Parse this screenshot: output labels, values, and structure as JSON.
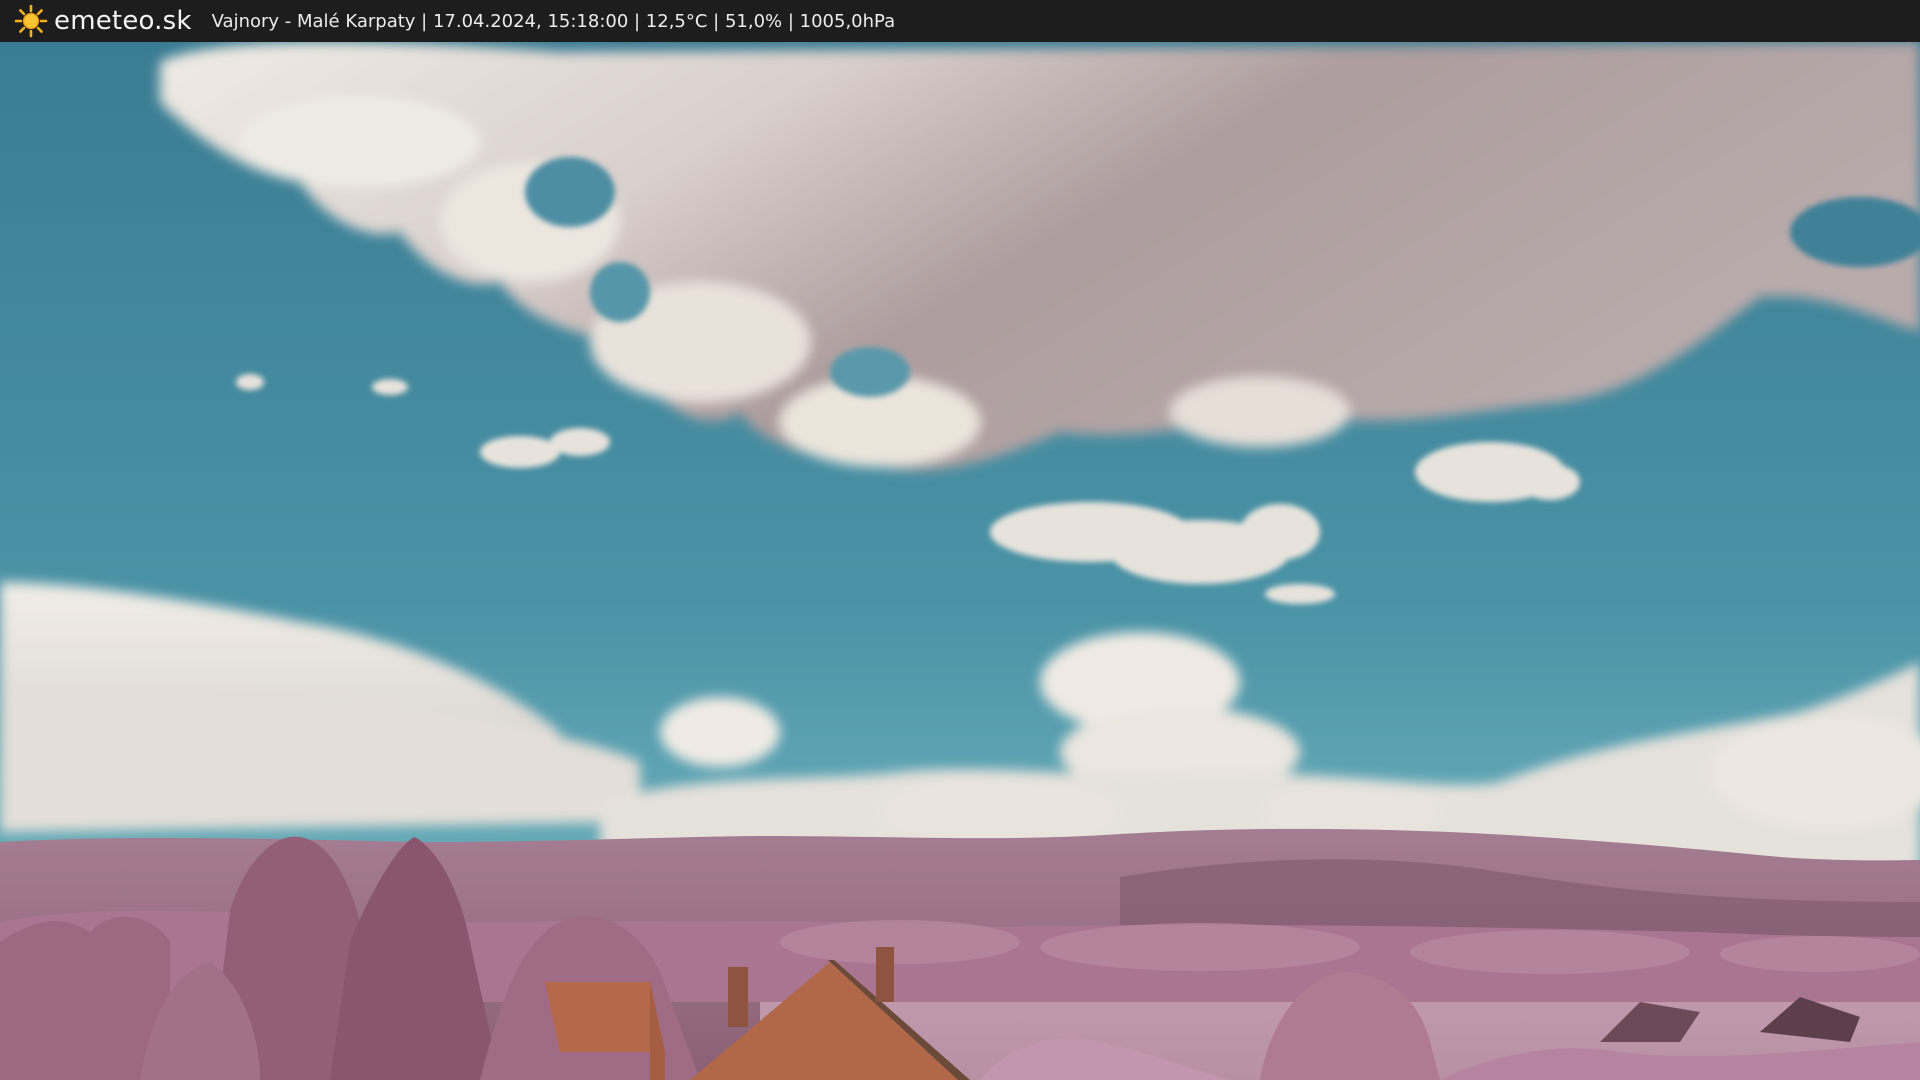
{
  "header": {
    "site_name": "emeteo.sk",
    "caption": "Vajnory - Malé Karpaty | 17.04.2024, 15:18:00 | 12,5°C | 51,0% | 1005,0hPa",
    "logo_icon": "sun-icon"
  },
  "colors": {
    "bar": "#1d1d1d",
    "sun": "#f6b21b",
    "sky_top": "#3a7f95",
    "sky_low": "#5aa2b2",
    "cloud_white": "#ece8e2",
    "cloud_grey": "#a89a9a",
    "foliage": "#b07a93",
    "roof": "#b36a4a"
  }
}
